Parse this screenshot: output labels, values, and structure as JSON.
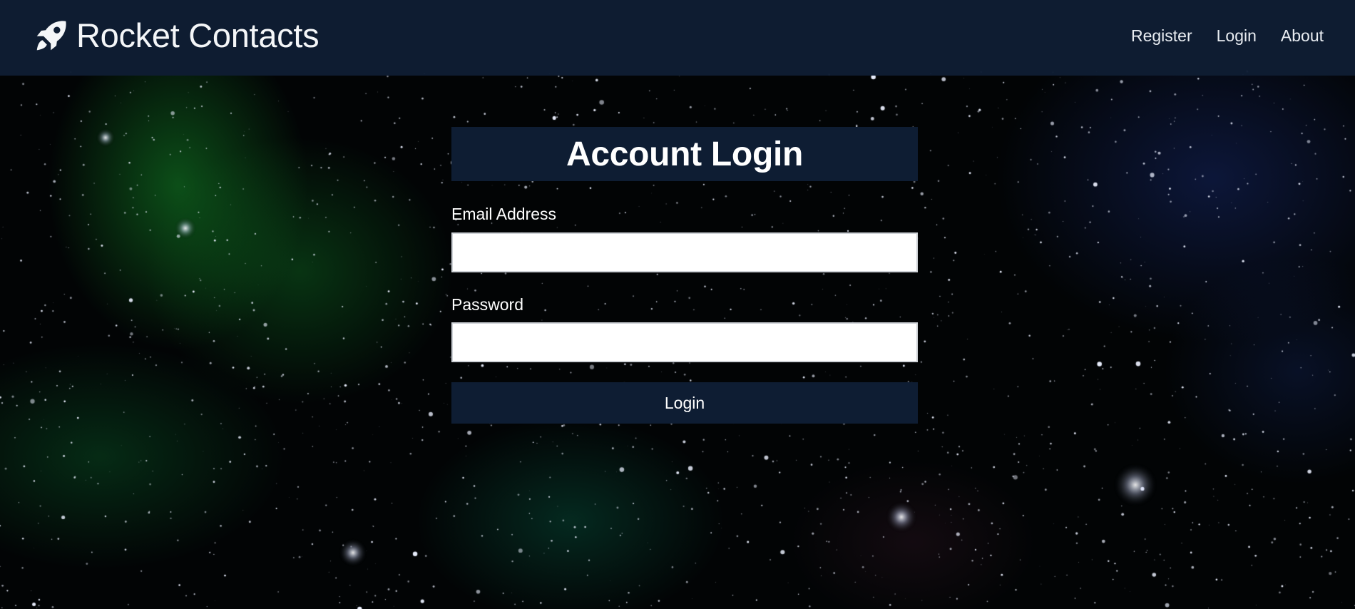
{
  "app": {
    "brand_name": "Rocket Contacts",
    "brand_icon": "rocket-icon"
  },
  "nav": {
    "links": [
      {
        "label": "Register"
      },
      {
        "label": "Login"
      },
      {
        "label": "About"
      }
    ]
  },
  "login": {
    "title": "Account Login",
    "email": {
      "label": "Email Address",
      "value": "",
      "placeholder": ""
    },
    "password": {
      "label": "Password",
      "value": "",
      "placeholder": ""
    },
    "submit_label": "Login"
  },
  "colors": {
    "navbar_bg": "#0e1d33",
    "card_accent": "#0e1d33",
    "text": "#ffffff",
    "background": "starfield-nebula"
  }
}
